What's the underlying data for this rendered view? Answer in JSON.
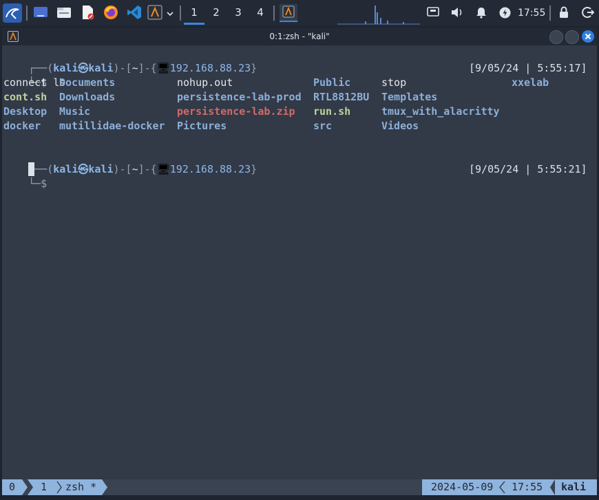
{
  "panel": {
    "apps": [
      {
        "name": "kali-menu-icon"
      },
      {
        "name": "desktop-icon"
      },
      {
        "name": "file-manager-icon"
      },
      {
        "name": "text-editor-icon"
      },
      {
        "name": "firefox-icon"
      },
      {
        "name": "vscode-icon"
      },
      {
        "name": "terminal-icon"
      }
    ],
    "workspaces": [
      "1",
      "2",
      "3",
      "4"
    ],
    "active_workspace": "1",
    "clock": "17:55"
  },
  "window": {
    "title": "0:1:zsh - \"kali\""
  },
  "terminal": {
    "prompt1": {
      "open": "┌──(",
      "user": "kali㉿kali",
      "mid": ")-[",
      "cwd": "~",
      "close": "]-{",
      "ip_icon": "🖥",
      "ip": "192.168.88.23",
      "end": "}",
      "line2_prefix": "└─$ ",
      "command": "ls",
      "timestamp": "[9/05/24 | 5:55:17]"
    },
    "ls": {
      "col1": [
        "connect",
        "cont.sh",
        "Desktop",
        "docker"
      ],
      "col2": [
        "Documents",
        "Downloads",
        "Music",
        "mutillidae-docker"
      ],
      "col3": [
        "nohup.out",
        "persistence-lab-prod",
        "persistence-lab.zip",
        "Pictures"
      ],
      "col4": [
        "Public",
        "RTL8812BU",
        "run.sh",
        "src"
      ],
      "col5": [
        "stop",
        "Templates",
        "tmux_with_alacritty",
        "Videos"
      ],
      "col6": [
        "xxelab"
      ]
    },
    "prompt2": {
      "open": "┌──(",
      "user": "kali㉿kali",
      "mid": ")-[",
      "cwd": "~",
      "close": "]-{",
      "ip_icon": "🖥",
      "ip": "192.168.88.23",
      "end": "}",
      "line2_prefix": "└─$ ",
      "timestamp": "[9/05/24 | 5:55:21]"
    }
  },
  "tmux": {
    "session": "0",
    "window_index": "1",
    "window_name": "zsh *",
    "date": "2024-05-09",
    "time": "17:55",
    "host": "kali"
  },
  "colors": {
    "accent": "#3a88e0",
    "terminal_bg": "#323947",
    "status_bg": "#3a4352",
    "status_accent": "#8fb4dd"
  }
}
